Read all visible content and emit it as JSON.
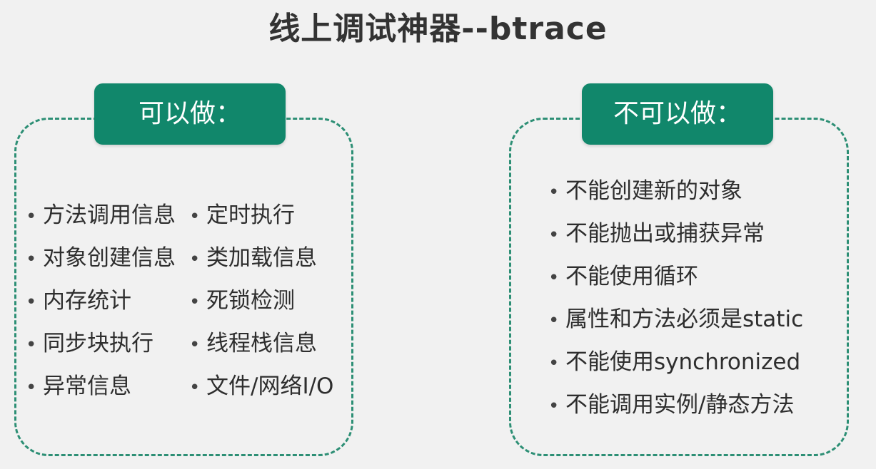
{
  "title": "线上调试神器--btrace",
  "can": {
    "label": "可以做：",
    "column1": [
      "方法调用信息",
      "对象创建信息",
      "内存统计",
      "同步块执行",
      "异常信息"
    ],
    "column2": [
      "定时执行",
      "类加载信息",
      "死锁检测",
      "线程栈信息",
      "文件/网络I/O"
    ]
  },
  "cannot": {
    "label": "不可以做：",
    "items": [
      "不能创建新的对象",
      "不能抛出或捕获异常",
      "不能使用循环",
      "属性和方法必须是static",
      "不能使用synchronized",
      "不能调用实例/静态方法"
    ]
  },
  "colors": {
    "accent": "#11876b",
    "dash": "#2d8f75",
    "background": "#f1f1f1"
  }
}
